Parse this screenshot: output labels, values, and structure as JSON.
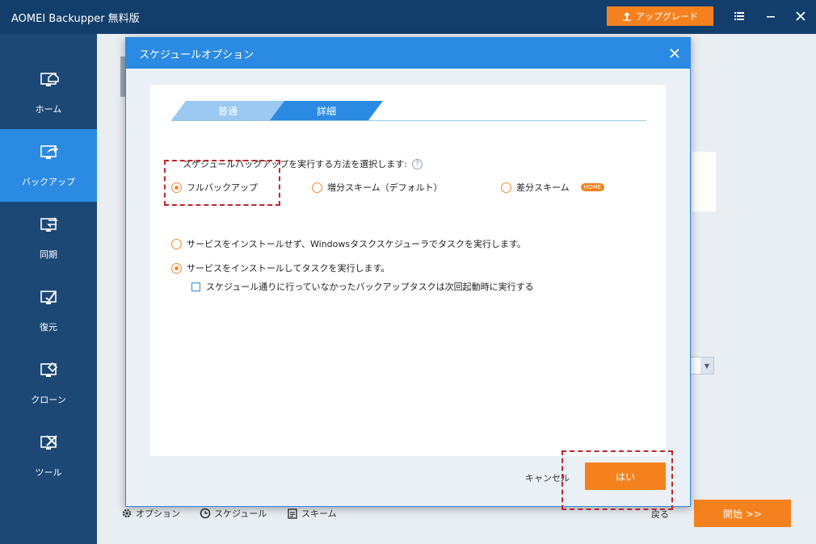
{
  "titlebar": {
    "app_title": "AOMEI Backupper 無料版",
    "upgrade_label": "アップグレード"
  },
  "sidebar": {
    "items": [
      {
        "label": "ホーム",
        "icon": "home-icon"
      },
      {
        "label": "バックアップ",
        "icon": "backup-icon",
        "active": true
      },
      {
        "label": "同期",
        "icon": "sync-icon"
      },
      {
        "label": "復元",
        "icon": "restore-icon"
      },
      {
        "label": "クローン",
        "icon": "clone-icon"
      },
      {
        "label": "ツール",
        "icon": "tools-icon"
      }
    ]
  },
  "bottom": {
    "options_label": "オプション",
    "schedule_label": "スケジュール",
    "scheme_label": "スキーム",
    "back_label": "戻る",
    "start_label": "開始 >>"
  },
  "dialog": {
    "title": "スケジュールオプション",
    "tabs": [
      {
        "label": "普通",
        "active": false
      },
      {
        "label": "詳細",
        "active": true
      }
    ],
    "prompt": "スケジュールバックアップを実行する方法を選択します:",
    "backup_methods": [
      {
        "label": "フルバックアップ",
        "selected": true
      },
      {
        "label": "増分スキーム（デフォルト）",
        "selected": false
      },
      {
        "label": "差分スキーム",
        "selected": false,
        "badge": "HOME"
      }
    ],
    "run_modes": [
      {
        "label": "サービスをインストールせず、Windowsタスクスケジューラでタスクを実行します。",
        "selected": false
      },
      {
        "label": "サービスをインストールしてタスクを実行します。",
        "selected": true
      }
    ],
    "missed_task_checkbox": {
      "label": "スケジュール通りに行っていなかったバックアップタスクは次回起動時に実行する",
      "checked": false
    },
    "cancel_label": "キャンセル",
    "ok_label": "はい"
  },
  "colors": {
    "accent_orange": "#f5811e",
    "dialog_blue": "#2b8ae1",
    "titlebar": "#123e6b",
    "sidebar": "#1c4876",
    "highlight_red": "#c0252a"
  }
}
